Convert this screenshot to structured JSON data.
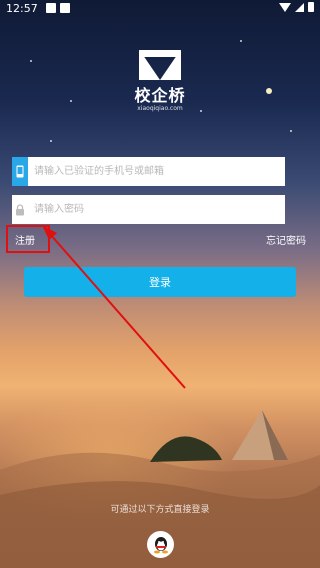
{
  "status_bar": {
    "time": "12:57"
  },
  "brand": {
    "name": "校企桥",
    "domain": "xiaoqiqiao.com"
  },
  "login_form": {
    "account_placeholder": "请输入已验证的手机号或邮箱",
    "password_placeholder": "请输入密码",
    "register_label": "注册",
    "forgot_label": "忘记密码",
    "login_label": "登录"
  },
  "alternate_login": {
    "hint": "可通过以下方式直接登录",
    "providers": [
      "qq-icon"
    ]
  },
  "colors": {
    "accent": "#14b0ea",
    "phone_icon_bg": "#2aa7e6",
    "annotation": "#e01010"
  }
}
